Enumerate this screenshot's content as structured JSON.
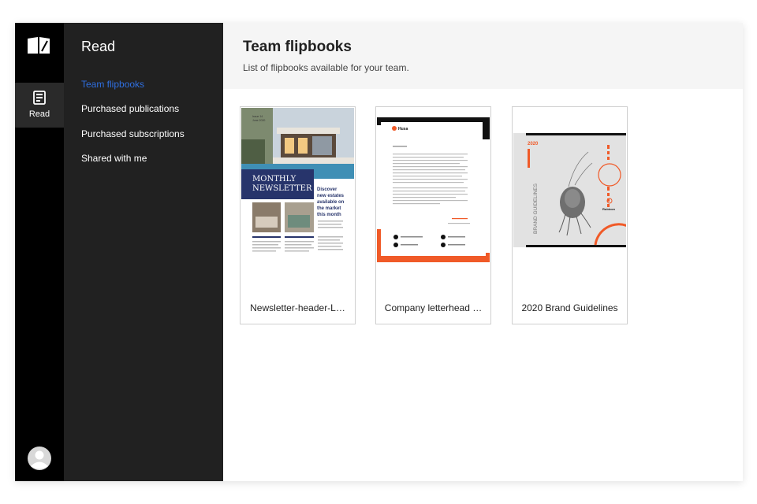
{
  "rail": {
    "logo_icon": "open-book-logo",
    "read_label": "Read",
    "read_icon": "document-icon",
    "avatar_icon": "user-avatar-icon"
  },
  "sidebar": {
    "title": "Read",
    "items": [
      {
        "label": "Team flipbooks",
        "active": true
      },
      {
        "label": "Purchased publications",
        "active": false
      },
      {
        "label": "Purchased subscriptions",
        "active": false
      },
      {
        "label": "Shared with me",
        "active": false
      }
    ]
  },
  "main": {
    "title": "Team flipbooks",
    "subtitle": "List of flipbooks available for your team."
  },
  "flipbooks": [
    {
      "title": "Newsletter-header-L…",
      "thumb": {
        "issue_line1": "Issue 14",
        "issue_line2": "June 2020",
        "banner_line1": "MONTHLY",
        "banner_line2": "NEWSLETTER",
        "teaser_line1": "Discover",
        "teaser_line2": "new estates",
        "teaser_line3": "available on",
        "teaser_line4": "the market",
        "teaser_line5": "this month"
      }
    },
    {
      "title": "Company letterhead …",
      "thumb": {
        "brand": "Husa"
      }
    },
    {
      "title": "2020 Brand Guidelines",
      "thumb": {
        "year": "2020",
        "vertical_text": "BRAND GUIDELINES",
        "brand": "Rubicon"
      }
    }
  ],
  "colors": {
    "rail": "#000000",
    "sidebar": "#212121",
    "active_link": "#2f6fe0",
    "header_bg": "#f5f5f5",
    "accent_orange": "#f05a28",
    "newsletter_navy": "#27346b"
  }
}
